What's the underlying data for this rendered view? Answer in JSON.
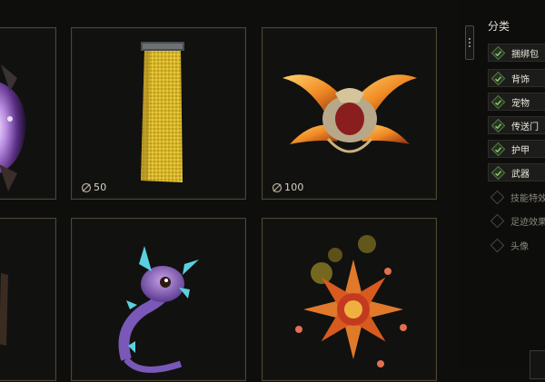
{
  "items": [
    {
      "id": "purple-portal",
      "price": null
    },
    {
      "id": "golden-banner",
      "price": "50"
    },
    {
      "id": "winged-helm",
      "price": "100"
    },
    {
      "id": "partial-left",
      "price": null
    },
    {
      "id": "spiky-dragon-pet",
      "price": null
    },
    {
      "id": "flower-effect",
      "price": null
    }
  ],
  "sidebar": {
    "title": "分类",
    "filters": [
      {
        "label": "捆绑包",
        "checked": true
      },
      {
        "label": "背饰",
        "checked": true
      },
      {
        "label": "宠物",
        "checked": true
      },
      {
        "label": "传送门",
        "checked": true
      },
      {
        "label": "护甲",
        "checked": true
      },
      {
        "label": "武器",
        "checked": true
      },
      {
        "label": "技能特效",
        "checked": false
      },
      {
        "label": "足迹效果",
        "checked": false
      },
      {
        "label": "头像",
        "checked": false
      }
    ]
  },
  "colors": {
    "accent_gold": "#c8a24a",
    "check_green": "#7fb25a",
    "card_border": "#4e4632"
  },
  "icons": {
    "currency": "coin-icon",
    "check": "check-icon",
    "scroll": "scroll-handle-icon"
  }
}
